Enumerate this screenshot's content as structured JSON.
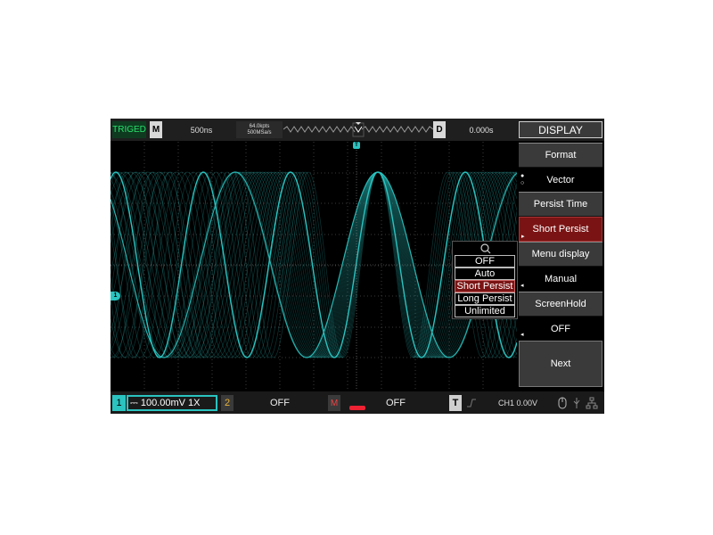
{
  "topbar": {
    "trigger_status": "TRIGED",
    "horizontal_badge": "M",
    "timebase": "500ns",
    "memory_depth": "64.0kpts",
    "sample_rate": "500MSa/s",
    "delay_badge": "D",
    "trigger_delay": "0.000s",
    "menu_title": "DISPLAY"
  },
  "menu": {
    "format_label": "Format",
    "format_value": "Vector",
    "persist_label": "Persist Time",
    "persist_value": "Short Persist",
    "menu_display_label": "Menu display",
    "menu_display_value": "Manual",
    "screenhold_label": "ScreenHold",
    "screenhold_value": "OFF",
    "next_label": "Next"
  },
  "popup": {
    "options": [
      "OFF",
      "Auto",
      "Short Persist",
      "Long Persist",
      "Unlimited"
    ],
    "selected": "Short Persist"
  },
  "bottombar": {
    "ch1_number": "1",
    "ch1_setting": "⎓ 100.00mV  1X",
    "ch2_number": "2",
    "ch2_value": "OFF",
    "math_badge": "M",
    "math_value": "OFF",
    "trigger_badge": "T",
    "trigger_level": "CH1  0.00V"
  },
  "markers": {
    "ch1_marker": "1",
    "trigger_marker": "T"
  },
  "colors": {
    "waveform": "#2ac3c0",
    "selected_menu": "#7a1414",
    "trigger_status_text": "#27e06a"
  }
}
